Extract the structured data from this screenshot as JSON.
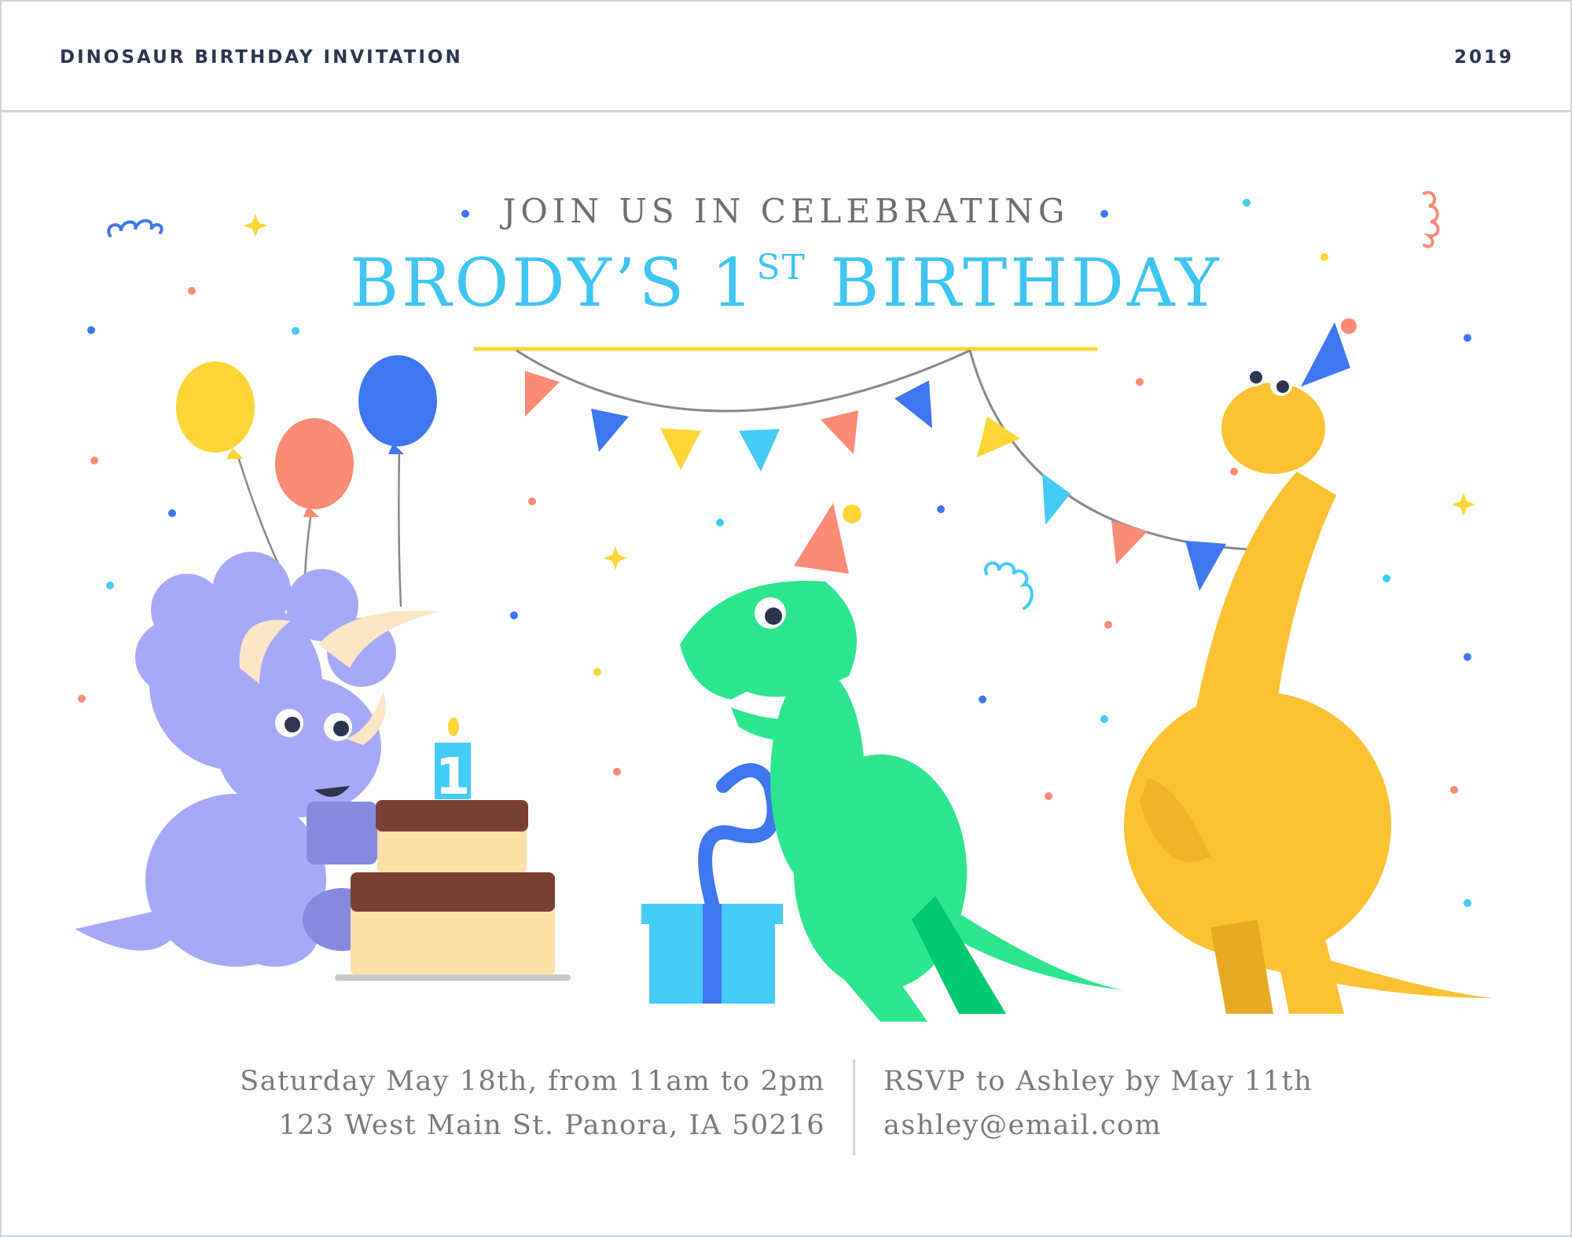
{
  "header": {
    "title": "DINOSAUR BIRTHDAY INVITATION",
    "year": "2019"
  },
  "invitation": {
    "eyebrow": "JOIN US IN CELEBRATING",
    "headline_main": "BRODY’S 1",
    "headline_superscript": "ST",
    "headline_tail": " BIRTHDAY",
    "date_time": "Saturday May 18th, from 11am to 2pm",
    "address": "123 West Main St. Panora, IA 50216",
    "rsvp": "RSVP to Ashley by May 11th",
    "email": "ashley@email.com",
    "cake_candle_number": "1"
  },
  "colors": {
    "headline": "#3ec5f2",
    "triceratops": "#a7a9f7",
    "trex": "#2de58e",
    "brontosaurus": "#fbc232",
    "pennant_red": "#f98b77",
    "pennant_blue": "#4076ef",
    "pennant_yellow": "#fdd536",
    "pennant_cyan": "#44ccf6"
  },
  "illustration_elements": [
    "balloon-icon",
    "bunting-icon",
    "triceratops-icon",
    "trex-icon",
    "brontosaurus-icon",
    "cake-icon",
    "gift-box-icon",
    "confetti-icon"
  ]
}
